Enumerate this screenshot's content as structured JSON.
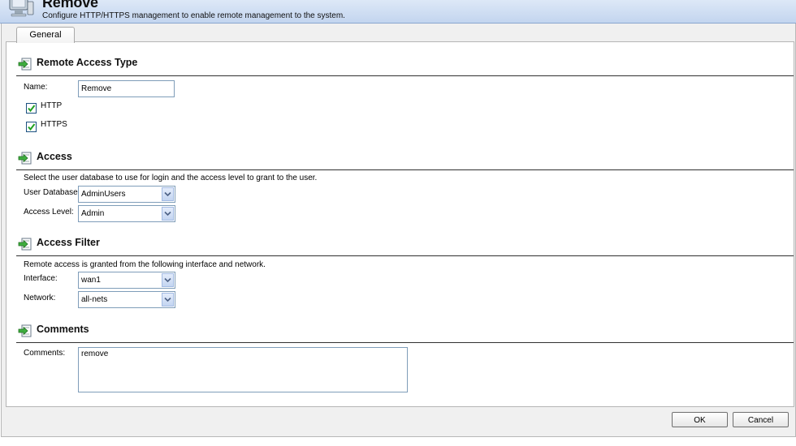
{
  "header": {
    "title": "Remove",
    "subtitle": "Configure HTTP/HTTPS management to enable remote management to the system.",
    "icon": "computer-monitor-icon"
  },
  "tabs": [
    {
      "label": "General",
      "active": true
    }
  ],
  "sections": {
    "remote_access_type": {
      "title": "Remote Access Type",
      "name_label": "Name:",
      "name_value": "Remove",
      "http_label": "HTTP",
      "http_checked": true,
      "https_label": "HTTPS",
      "https_checked": true
    },
    "access": {
      "title": "Access",
      "description": "Select the user database to use for login and the access level to grant to the user.",
      "user_database_label": "User Database:",
      "user_database_value": "AdminUsers",
      "access_level_label": "Access Level:",
      "access_level_value": "Admin"
    },
    "access_filter": {
      "title": "Access Filter",
      "description": "Remote access is granted from the following interface and network.",
      "interface_label": "Interface:",
      "interface_value": "wan1",
      "network_label": "Network:",
      "network_value": "all-nets"
    },
    "comments": {
      "title": "Comments",
      "comments_label": "Comments:",
      "comments_value": "remove"
    }
  },
  "buttons": {
    "ok_label": "OK",
    "cancel_label": "Cancel"
  },
  "colors": {
    "header_gradient_top": "#dde8f7",
    "header_gradient_bottom": "#c3d5ef",
    "input_border": "#7f9db9"
  }
}
